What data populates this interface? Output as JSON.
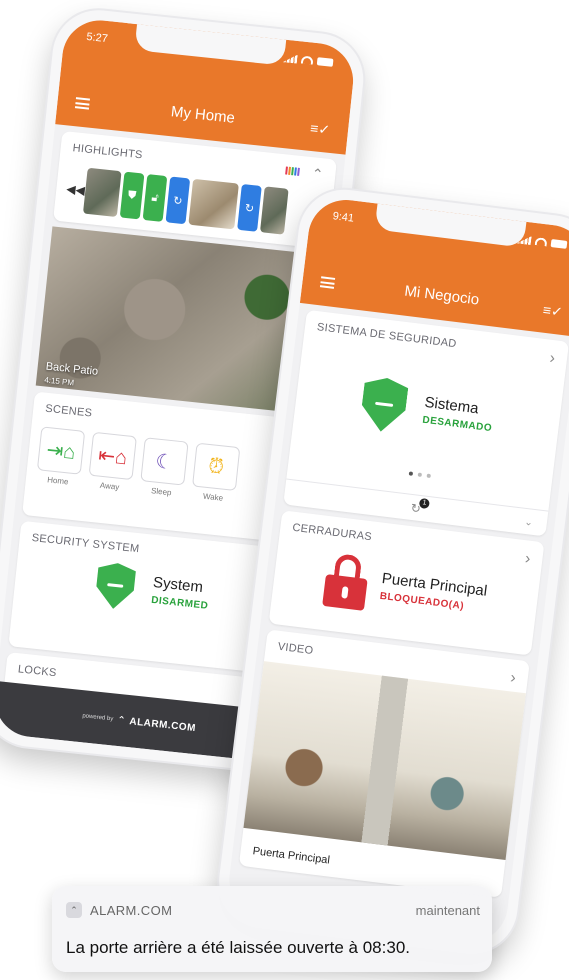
{
  "back_phone": {
    "status_time": "5:27",
    "title": "My Home",
    "highlights": {
      "title": "HIGHLIGHTS",
      "legend_colors": [
        "#e53b56",
        "#f08a2c",
        "#3bb04e",
        "#2f7de1",
        "#8a5cd6"
      ]
    },
    "camera": {
      "label": "Back Patio",
      "time": "4:15 PM"
    },
    "scenes": {
      "title": "SCENES",
      "items": [
        {
          "label": "Home",
          "icon": "home-arrive-icon",
          "color": "#3bb04e"
        },
        {
          "label": "Away",
          "icon": "home-leave-icon",
          "color": "#d8323a"
        },
        {
          "label": "Sleep",
          "icon": "moon-icon",
          "color": "#6a4bb5"
        },
        {
          "label": "Wake",
          "icon": "alarm-clock-icon",
          "color": "#f2b51d"
        }
      ]
    },
    "security": {
      "title": "SECURITY SYSTEM",
      "name": "System",
      "status": "DISARMED"
    },
    "locks": {
      "title": "LOCKS"
    },
    "powered": {
      "prefix": "powered by",
      "brand": "ALARM.COM"
    }
  },
  "front_phone": {
    "status_time": "9:41",
    "title": "Mi Negocio",
    "security": {
      "title": "SISTEMA DE SEGURIDAD",
      "name": "Sistema",
      "status": "DESARMADO",
      "badge_count": "1"
    },
    "locks": {
      "title": "CERRADURAS",
      "name": "Puerta Principal",
      "status": "BLOQUEADO(A)"
    },
    "video": {
      "title": "VIDEO",
      "camera_label": "Puerta Principal"
    }
  },
  "notification": {
    "app": "ALARM.COM",
    "time": "maintenant",
    "message": "La porte arrière a été laissée ouverte à 08:30."
  },
  "colors": {
    "brand_orange": "#e9782a",
    "armed_green": "#3bb04e",
    "locked_red": "#d8323a"
  }
}
